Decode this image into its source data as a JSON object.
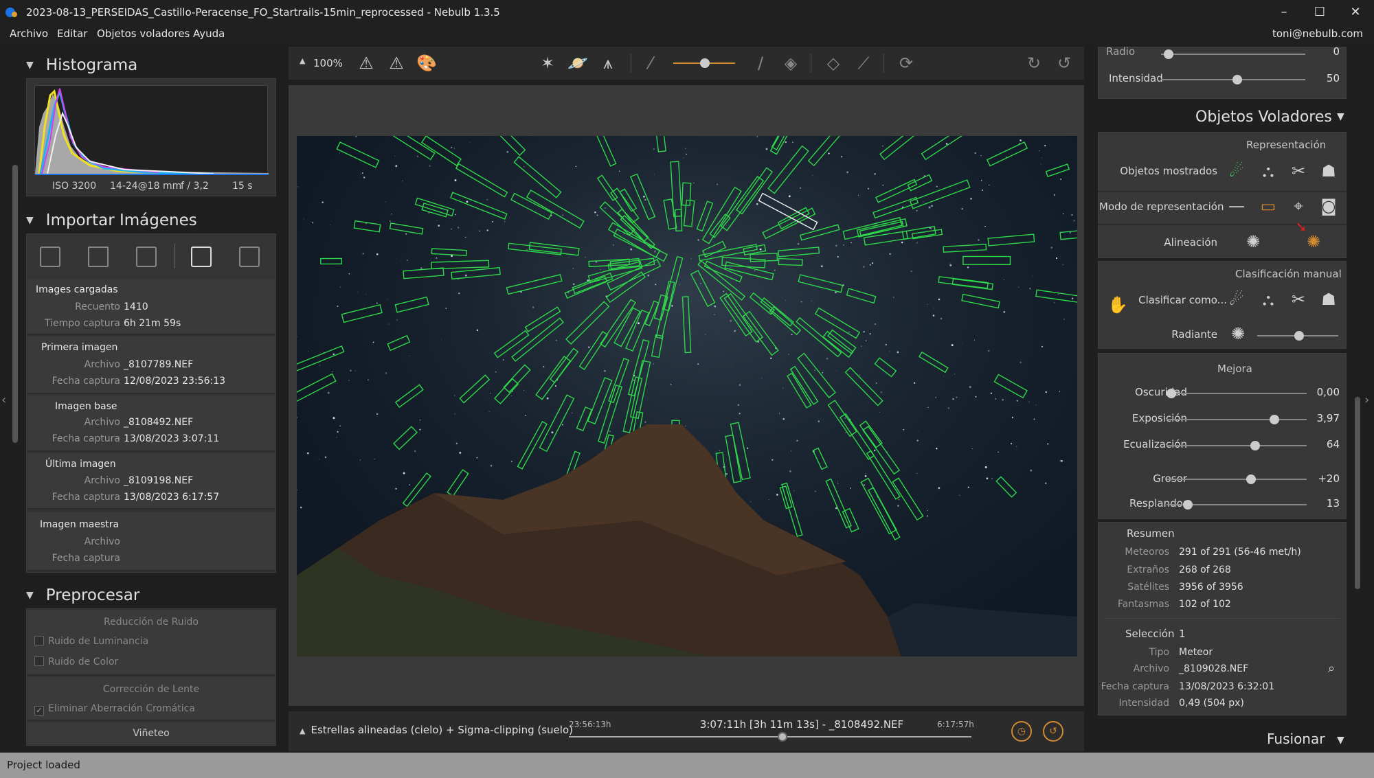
{
  "window": {
    "title": "2023-08-13_PERSEIDAS_Castillo-Peracense_FO_Startrails-15min_reprocessed - Nebulb 1.3.5",
    "minimize": "–",
    "maximize": "☐",
    "close": "✕"
  },
  "menu": {
    "items": [
      "Archivo",
      "Editar",
      "Objetos voladores",
      "Ayuda"
    ],
    "user": "toni@nebulb.com"
  },
  "histogram": {
    "title": "Histograma",
    "iso": "ISO 3200",
    "lens": "14-24@18 mm",
    "aperture": "f / 3,2",
    "exposure": "15 s"
  },
  "import": {
    "title": "Importar Imágenes",
    "loaded": {
      "title": "Images cargadas",
      "count_label": "Recuento",
      "count": "1410",
      "time_label": "Tiempo captura",
      "time": "6h 21m 59s"
    },
    "first": {
      "title": "Primera imagen",
      "file_label": "Archivo",
      "file": "_8107789.NEF",
      "date_label": "Fecha captura",
      "date": "12/08/2023 23:56:13"
    },
    "base": {
      "title": "Imagen base",
      "file_label": "Archivo",
      "file": "_8108492.NEF",
      "date_label": "Fecha captura",
      "date": "13/08/2023 3:07:11"
    },
    "last": {
      "title": "Última imagen",
      "file_label": "Archivo",
      "file": "_8109198.NEF",
      "date_label": "Fecha captura",
      "date": "13/08/2023 6:17:57"
    },
    "master": {
      "title": "Imagen maestra",
      "file_label": "Archivo",
      "date_label": "Fecha captura"
    }
  },
  "preprocess": {
    "title": "Preprocesar",
    "noise_title": "Reducción de Ruido",
    "luminance": "Ruido de Luminancia",
    "color": "Ruido de Color",
    "lens_title": "Corrección de Lente",
    "chromatic": "Eliminar Aberración Cromática",
    "vignette": "Viñeteo"
  },
  "toolbar": {
    "zoom": "100%"
  },
  "bottombar": {
    "mode": "Estrellas alineadas (cielo) + Sigma-clipping (suelo)",
    "start_time": "23:56:13h",
    "center": "3:07:11h [3h 11m 13s] - _8108492.NEF",
    "end_time": "6:17:57h"
  },
  "right": {
    "radio_label": "Radio",
    "radio_value": "0",
    "intensity_label": "Intensidad",
    "intensity_value": "50",
    "flying_title": "Objetos Voladores",
    "representation_title": "Representación",
    "shown_label": "Objetos mostrados",
    "mode_label": "Modo de representación",
    "align_label": "Alineación",
    "manual_title": "Clasificación manual",
    "classify_label": "Clasificar como...",
    "radiant_label": "Radiante",
    "improve_title": "Mejora",
    "darkness_label": "Oscuridad",
    "darkness_value": "0,00",
    "exposure_label": "Exposición",
    "exposure_value": "3,97",
    "equalization_label": "Ecualización",
    "equalization_value": "64",
    "thickness_label": "Grosor",
    "thickness_value": "+20",
    "glow_label": "Resplandor",
    "glow_value": "13",
    "fuse_title": "Fusionar"
  },
  "summary": {
    "title": "Resumen",
    "meteors_label": "Meteoros",
    "meteors": "291 of 291 (56-46 met/h)",
    "strange_label": "Extraños",
    "strange": "268 of 268",
    "satellites_label": "Satélites",
    "satellites": "3956 of 3956",
    "ghosts_label": "Fantasmas",
    "ghosts": "102 of 102"
  },
  "selection": {
    "title": "Selección",
    "count": "1",
    "type_label": "Tipo",
    "type": "Meteor",
    "file_label": "Archivo",
    "file": "_8109028.NEF",
    "date_label": "Fecha captura",
    "date": "13/08/2023 6:32:01",
    "intensity_label": "Intensidad",
    "intensity": "0,49 (504 px)"
  },
  "status": {
    "text": "Project loaded"
  }
}
